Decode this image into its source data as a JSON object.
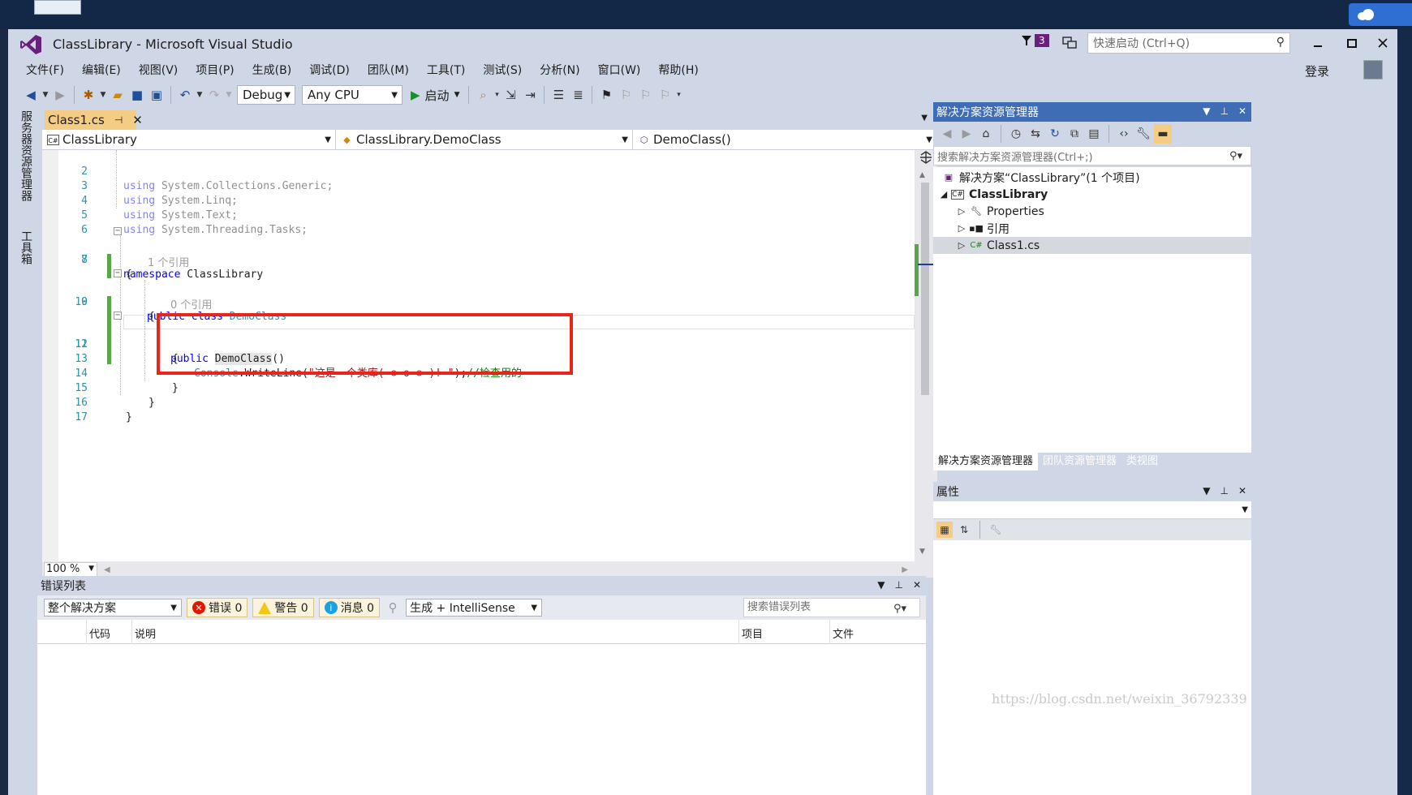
{
  "window": {
    "title": "ClassLibrary - Microsoft Visual Studio",
    "notification_count": "3",
    "quick_launch_placeholder": "快速启动 (Ctrl+Q)",
    "login": "登录"
  },
  "menu": [
    "文件(F)",
    "编辑(E)",
    "视图(V)",
    "项目(P)",
    "生成(B)",
    "调试(D)",
    "团队(M)",
    "工具(T)",
    "测试(S)",
    "分析(N)",
    "窗口(W)",
    "帮助(H)"
  ],
  "toolbar": {
    "config": "Debug",
    "platform": "Any CPU",
    "start": "启动"
  },
  "left_tabs": [
    "服务器资源管理器",
    "工具箱"
  ],
  "document": {
    "tab": "Class1.cs",
    "nav_project": "ClassLibrary",
    "nav_class": "ClassLibrary.DemoClass",
    "nav_member": "DemoClass()",
    "zoom": "100 %"
  },
  "code": {
    "l2": {
      "num": "2",
      "kw": "using",
      "rest": " System.Collections.Generic;"
    },
    "l3": {
      "num": "3",
      "kw": "using",
      "rest": " System.Linq;"
    },
    "l4": {
      "num": "4",
      "kw": "using",
      "rest": " System.Text;"
    },
    "l5": {
      "num": "5",
      "kw": "using",
      "rest": " System.Threading.Tasks;"
    },
    "l6": {
      "num": "6"
    },
    "l7": {
      "num": "7",
      "kw": "namespace",
      "rest": " ClassLibrary"
    },
    "l8": {
      "num": "8",
      "text": "{"
    },
    "lens1": "1 个引用",
    "l9": {
      "num": "9",
      "kw1": "public",
      "kw2": "class",
      "cls": "DemoClass"
    },
    "l10": {
      "num": "10",
      "text": "{"
    },
    "lens2": "0 个引用",
    "l11": {
      "num": "11",
      "kw": "public",
      "name": "DemoClass",
      "rest": "()"
    },
    "l12": {
      "num": "12",
      "text": "{"
    },
    "l13": {
      "num": "13",
      "cls": "Console",
      "method": ".WriteLine(",
      "str": "\"这是一个类库( ⊙ o ⊙ )! \"",
      "end": ");",
      "comment": "//检查用的"
    },
    "l14": {
      "num": "14",
      "text": "}"
    },
    "l15": {
      "num": "15",
      "text": "}"
    },
    "l16": {
      "num": "16",
      "text": "}"
    },
    "l17": {
      "num": "17"
    }
  },
  "solution_explorer": {
    "title": "解决方案资源管理器",
    "search_placeholder": "搜索解决方案资源管理器(Ctrl+;)",
    "solution": "解决方案“ClassLibrary”(1 个项目)",
    "project": "ClassLibrary",
    "items": [
      "Properties",
      "引用",
      "Class1.cs"
    ],
    "tabs": [
      "解决方案资源管理器",
      "团队资源管理器",
      "类视图"
    ]
  },
  "properties": {
    "title": "属性"
  },
  "error_list": {
    "title": "错误列表",
    "scope": "整个解决方案",
    "errors": "错误 0",
    "warnings": "警告 0",
    "messages": "消息 0",
    "source": "生成 + IntelliSense",
    "search_placeholder": "搜索错误列表",
    "columns": [
      "代码",
      "说明",
      "项目",
      "文件"
    ]
  },
  "watermark": "https://blog.csdn.net/weixin_36792339",
  "colors": {
    "accent": "#3e6cb5",
    "active_tab": "#f5cc84",
    "highlight_box": "#e8241c",
    "vs_purple": "#68217a"
  }
}
